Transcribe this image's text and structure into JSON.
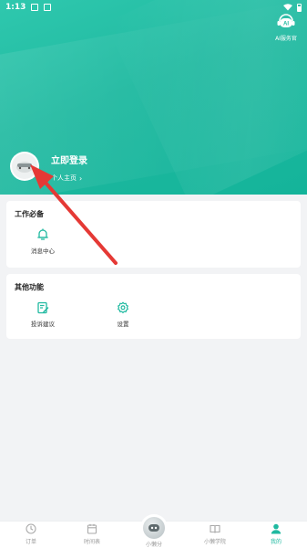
{
  "status_bar": {
    "time": "1:13"
  },
  "colors": {
    "brand": "#1fb9a0",
    "annotation_arrow": "#e53935"
  },
  "header": {
    "ai_button": {
      "label": "AI服务官",
      "icon": "robot-icon"
    },
    "login_title": "立即登录",
    "homepage_link": "个人主页"
  },
  "work_section": {
    "title": "工作必备",
    "items": [
      {
        "label": "消息中心",
        "icon": "bell-icon"
      }
    ]
  },
  "other_section": {
    "title": "其他功能",
    "items": [
      {
        "label": "投诉建议",
        "icon": "feedback-edit-icon"
      },
      {
        "label": "设置",
        "icon": "gear-icon"
      }
    ]
  },
  "tabbar": {
    "items": [
      {
        "label": "订单",
        "icon": "clock-icon",
        "active": false
      },
      {
        "label": "时间表",
        "icon": "calendar-icon",
        "active": false
      },
      {
        "label": "小懒分",
        "icon": "chat-bubble-icon",
        "active": false
      },
      {
        "label": "小懒学院",
        "icon": "book-icon",
        "active": false
      },
      {
        "label": "我的",
        "icon": "user-icon",
        "active": true
      }
    ]
  }
}
